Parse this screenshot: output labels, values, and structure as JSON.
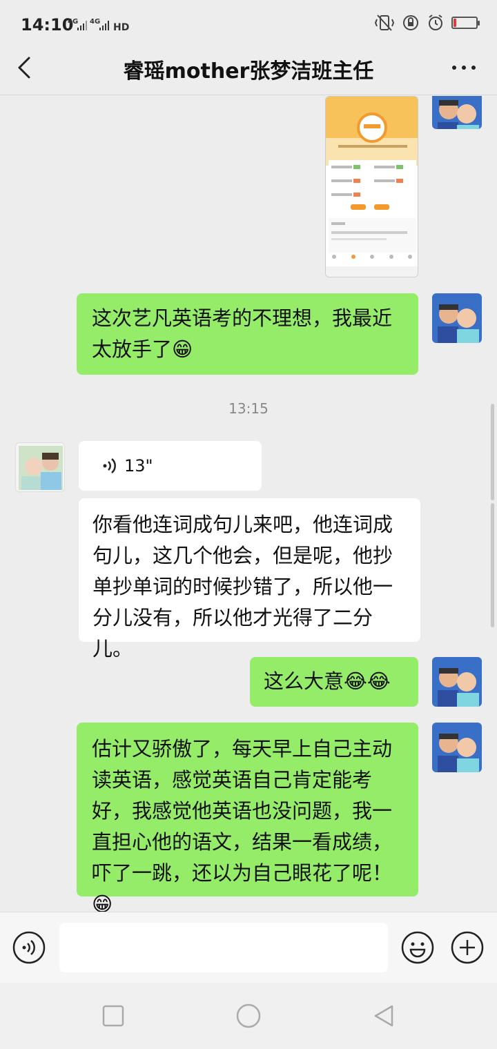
{
  "status_bar": {
    "time": "14:10",
    "network_label": "4G ıll 4G ıll HD",
    "battery_level": 0.12,
    "icons": [
      "vibrate-icon",
      "lock-rotation-icon",
      "alarm-icon",
      "battery-icon"
    ]
  },
  "header": {
    "title": "睿瑶mother张梦洁班主任",
    "back_icon": "chevron-left-icon",
    "more_icon": "more-dots-icon"
  },
  "messages": [
    {
      "id": "m1",
      "sender": "me",
      "type": "image",
      "description_icon": "screenshot-image"
    },
    {
      "id": "m2",
      "sender": "me",
      "type": "text",
      "text": "这次艺凡英语考的不理想，我最近太放手了😁"
    },
    {
      "id": "m3",
      "type": "timestamp",
      "text": "13:15"
    },
    {
      "id": "m4",
      "sender": "them",
      "type": "voice",
      "duration": "13\""
    },
    {
      "id": "m5",
      "sender": "them",
      "type": "text",
      "text": "你看他连词成句儿来吧，他连词成句儿，这几个他会，但是呢，他抄单抄单词的时候抄错了，所以他一分儿没有，所以他才光得了二分儿。"
    },
    {
      "id": "m6",
      "sender": "me",
      "type": "text",
      "text": "这么大意😂😂"
    },
    {
      "id": "m7",
      "sender": "me",
      "type": "text",
      "text": "估计又骄傲了，每天早上自己主动读英语，感觉英语自己肯定能考好，我感觉他英语也没问题，我一直担心他的语文，结果一看成绩，吓了一跳，还以为自己眼花了呢！😁"
    }
  ],
  "input_bar": {
    "voice_icon": "voice-input-icon",
    "emoji_icon": "emoji-icon",
    "plus_icon": "plus-icon",
    "input_value": ""
  },
  "nav_bar": {
    "icons": [
      "recent-apps-icon",
      "home-icon",
      "back-triangle-icon"
    ]
  },
  "colors": {
    "my_bubble": "#95ec69",
    "their_bubble": "#ffffff",
    "background": "#ededed"
  }
}
